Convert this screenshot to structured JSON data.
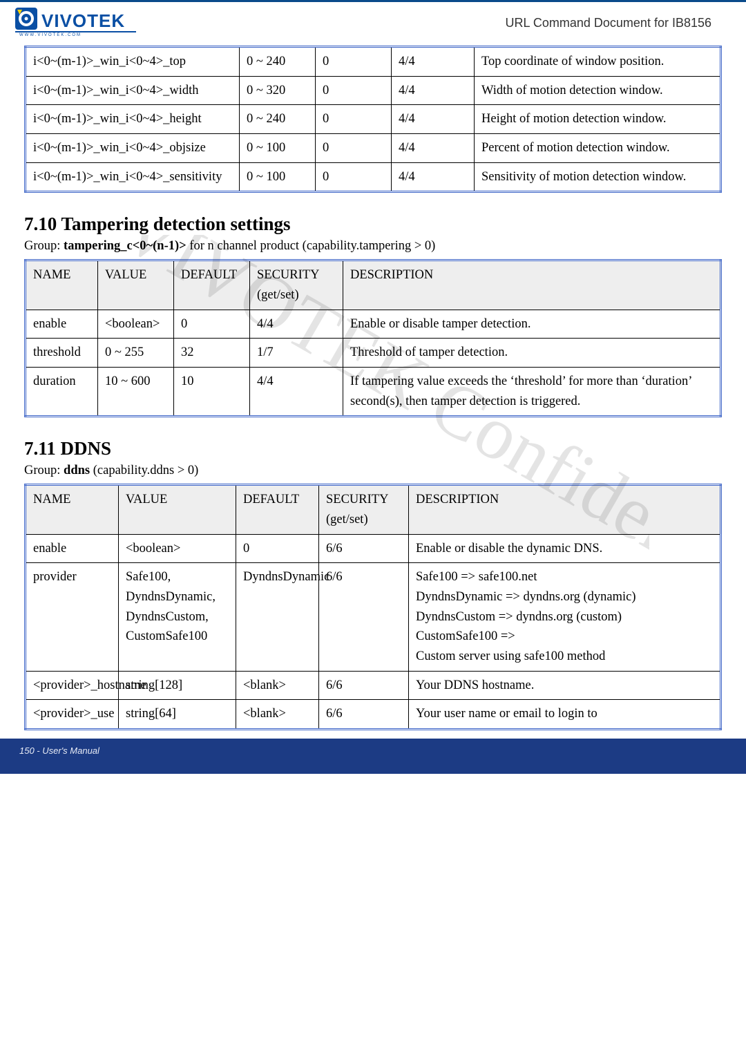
{
  "header": {
    "doc_title": "URL Command Document for IB8156"
  },
  "table1": {
    "rows": [
      {
        "name": "i<0~(m-1)>_win_i<0~4>_top",
        "value": "0 ~ 240",
        "default": "0",
        "security": "4/4",
        "desc": "Top coordinate of window position."
      },
      {
        "name": "i<0~(m-1)>_win_i<0~4>_width",
        "value": "0 ~ 320",
        "default": "0",
        "security": "4/4",
        "desc": "Width of motion detection window."
      },
      {
        "name": "i<0~(m-1)>_win_i<0~4>_height",
        "value": "0 ~ 240",
        "default": "0",
        "security": "4/4",
        "desc": "Height of motion detection window."
      },
      {
        "name": "i<0~(m-1)>_win_i<0~4>_objsize",
        "value": "0 ~ 100",
        "default": "0",
        "security": "4/4",
        "desc": "Percent of motion detection window."
      },
      {
        "name": "i<0~(m-1)>_win_i<0~4>_sensitivity",
        "value": "0 ~ 100",
        "default": "0",
        "security": "4/4",
        "desc": "Sensitivity of motion detection window."
      }
    ]
  },
  "section_tampering": {
    "heading": "7.10 Tampering detection settings",
    "group_prefix": "Group: ",
    "group_bold": "tampering_c<0~(n-1)>",
    "group_suffix": " for n channel product (capability.tampering > 0)",
    "headers": {
      "name": "NAME",
      "value": "VALUE",
      "default": "DEFAULT",
      "security": "SECURITY",
      "security2": "(get/set)",
      "desc": "DESCRIPTION"
    },
    "rows": [
      {
        "name": "enable",
        "value": "<boolean>",
        "default": "0",
        "security": "4/4",
        "desc": "Enable or disable tamper detection."
      },
      {
        "name": "threshold",
        "value": "0 ~ 255",
        "default": "32",
        "security": "1/7",
        "desc": "Threshold of tamper detection."
      },
      {
        "name": "duration",
        "value": "10 ~ 600",
        "default": "10",
        "security": "4/4",
        "desc": "If tampering value exceeds the ‘threshold’ for more than ‘duration’ second(s), then tamper detection is triggered."
      }
    ]
  },
  "section_ddns": {
    "heading": "7.11 DDNS",
    "group_prefix": "Group: ",
    "group_bold": "ddns",
    "group_suffix": " (capability.ddns > 0)",
    "headers": {
      "name": "NAME",
      "value": "VALUE",
      "default": "DEFAULT",
      "security": "SECURITY",
      "security2": "(get/set)",
      "desc": "DESCRIPTION"
    },
    "rows": [
      {
        "name": "enable",
        "value": "<boolean>",
        "default": "0",
        "security": "6/6",
        "desc": "Enable or disable the dynamic DNS."
      },
      {
        "name": "provider",
        "value": "Safe100, DyndnsDynamic, DyndnsCustom, CustomSafe100",
        "default": "DyndnsDynamic",
        "security": "6/6",
        "desc": "Safe100 => safe100.net\nDyndnsDynamic => dyndns.org (dynamic)\nDyndnsCustom => dyndns.org (custom)\nCustomSafe100 =>\nCustom server using safe100 method"
      },
      {
        "name": "<provider>_hostname",
        "value": "string[128]",
        "default": "<blank>",
        "security": "6/6",
        "desc": "Your DDNS hostname."
      },
      {
        "name": "<provider>_use",
        "value": "string[64]",
        "default": "<blank>",
        "security": "6/6",
        "desc": "Your user name or email to login to"
      }
    ]
  },
  "footer": {
    "text": "150 - User's Manual"
  }
}
